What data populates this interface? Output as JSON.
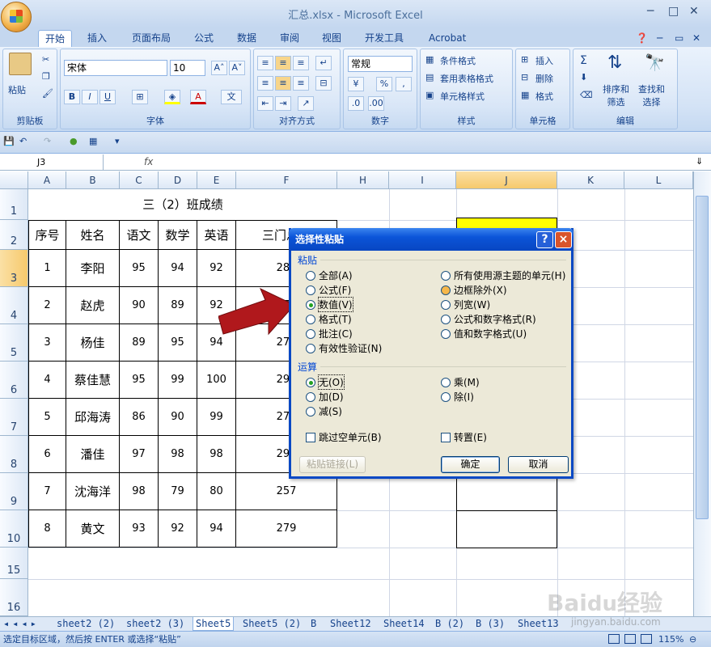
{
  "window": {
    "title": "汇总.xlsx - Microsoft Excel"
  },
  "ribbon": {
    "tabs": [
      "开始",
      "插入",
      "页面布局",
      "公式",
      "数据",
      "审阅",
      "视图",
      "开发工具",
      "Acrobat"
    ],
    "clipboard": {
      "paste": "粘贴",
      "label": "剪贴板"
    },
    "font": {
      "name": "宋体",
      "size": "10",
      "label": "字体"
    },
    "alignment": {
      "label": "对齐方式"
    },
    "number": {
      "format": "常规",
      "label": "数字"
    },
    "styles": {
      "conditional": "条件格式",
      "table": "套用表格格式",
      "cell": "单元格样式",
      "label": "样式"
    },
    "cells": {
      "insert": "插入",
      "delete": "删除",
      "format": "格式",
      "label": "单元格"
    },
    "editing": {
      "sort": "排序和\n筛选",
      "find": "查找和\n选择",
      "label": "编辑"
    }
  },
  "formula_bar": {
    "name_box": "J3",
    "fx": "fx"
  },
  "columns": [
    "A",
    "B",
    "C",
    "D",
    "E",
    "F",
    "H",
    "I",
    "J",
    "K",
    "L"
  ],
  "rows": [
    "1",
    "2",
    "3",
    "4",
    "5",
    "6",
    "7",
    "8",
    "9",
    "10",
    "15",
    "16"
  ],
  "table": {
    "title": "三（2）班成绩",
    "headers": [
      "序号",
      "姓名",
      "语文",
      "数学",
      "英语",
      "三门总分"
    ],
    "rows": [
      [
        "1",
        "李阳",
        "95",
        "94",
        "92",
        "281"
      ],
      [
        "2",
        "赵虎",
        "90",
        "89",
        "92",
        "271"
      ],
      [
        "3",
        "杨佳",
        "89",
        "95",
        "94",
        "278"
      ],
      [
        "4",
        "蔡佳慧",
        "95",
        "99",
        "100",
        "294"
      ],
      [
        "5",
        "邱海涛",
        "86",
        "90",
        "99",
        "275"
      ],
      [
        "6",
        "潘佳",
        "97",
        "98",
        "98",
        "293"
      ],
      [
        "7",
        "沈海洋",
        "98",
        "79",
        "80",
        "257"
      ],
      [
        "8",
        "黄文",
        "93",
        "92",
        "94",
        "279"
      ]
    ]
  },
  "dialog": {
    "title": "选择性粘贴",
    "paste_section": "粘贴",
    "paste_left": [
      "全部(A)",
      "公式(F)",
      "数值(V)",
      "格式(T)",
      "批注(C)",
      "有效性验证(N)"
    ],
    "paste_right": [
      "所有使用源主题的单元(H)",
      "边框除外(X)",
      "列宽(W)",
      "公式和数字格式(R)",
      "值和数字格式(U)"
    ],
    "operation_section": "运算",
    "op_left": [
      "无(O)",
      "加(D)",
      "减(S)"
    ],
    "op_right": [
      "乘(M)",
      "除(I)"
    ],
    "skip_blanks": "跳过空单元(B)",
    "transpose": "转置(E)",
    "paste_link": "粘贴链接(L)",
    "ok": "确定",
    "cancel": "取消",
    "help": "?",
    "close": "×"
  },
  "sheet_tabs": [
    "sheet2 (2)",
    "sheet2 (3)",
    "Sheet5",
    "Sheet5 (2)",
    "B",
    "Sheet12",
    "Sheet14",
    "B (2)",
    "B (3)",
    "Sheet13"
  ],
  "status": {
    "message": "选定目标区域，然后按 ENTER 或选择“粘贴”",
    "zoom": "115%"
  },
  "watermark": "Baidu经验 jingyan.baidu.com",
  "colors": {
    "selected_fill": "#ffff00",
    "arrow": "#b0181c",
    "accent": "#0a49c4"
  }
}
